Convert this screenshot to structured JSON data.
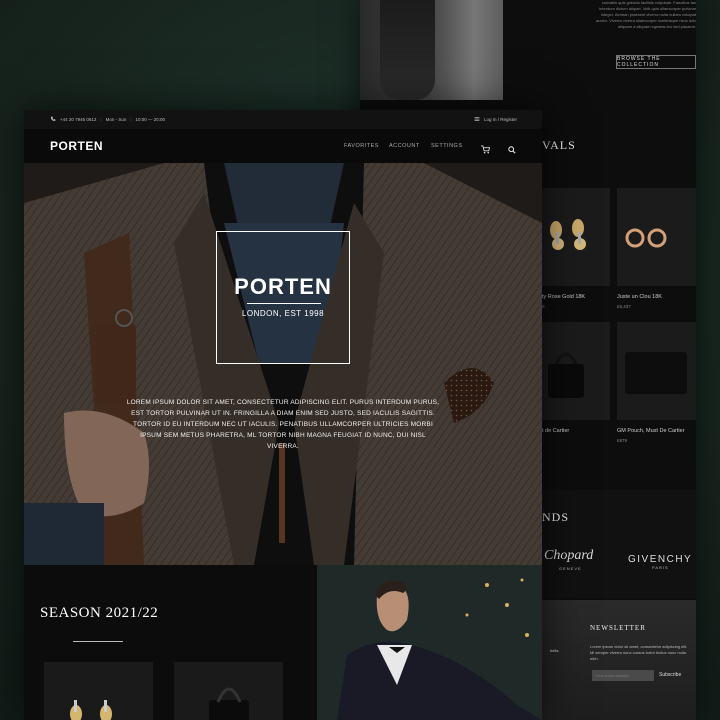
{
  "back": {
    "blurb_lines": [
      "convallis quis gravida facilisis vulputate. Faucibus fac",
      "Interdum dictum aliquet. Velit quis ullamcorper pulvinar",
      "integer. Aenean praesent viverra nulla nullam volutpat",
      "auctor. Viverra viverra ullamcorper scelerisque risus dolor",
      "aliquam a aliquam egestas leo sed placerat."
    ],
    "browse_label": "BROWSE THE COLLECTION",
    "arrivals_title": "VALS",
    "products": [
      {
        "name": "ty Rose Gold 18K",
        "price": "0"
      },
      {
        "name": "Juste un Clou 18K",
        "price": "£6,437"
      },
      {
        "name": "t de Cartier",
        "price": ""
      },
      {
        "name": "GM Pouch, Must De Cartier",
        "price": "£879"
      }
    ],
    "brands_title": "NDS",
    "brands": [
      {
        "name": "Chopard",
        "sub": "GENEVE"
      },
      {
        "name": "GIVENCHY",
        "sub": "PARIS"
      }
    ],
    "newsletter": {
      "title": "NEWSLETTER",
      "text": "Lorem ipsum dolor sit amet, consectetur adipiscing elit. Mi semper viverra nunc cursus tortor lectus nunc nulla nibh.",
      "side_label": "belts",
      "input_placeholder": "Your email address",
      "subscribe_label": "Subscribe"
    }
  },
  "topbar": {
    "phone": "+44 20 7946 0612",
    "days": "Mon - Sun",
    "hours": "10:00 — 20:00",
    "login": "Log In / Register"
  },
  "nav": {
    "logo": "PORTEN",
    "links": [
      "FAVORITES",
      "ACCOUNT",
      "SETTINGS"
    ]
  },
  "hero": {
    "brand": "PORTEN",
    "est": "LONDON, EST 1998",
    "text": "LOREM IPSUM DOLOR SIT AMET, CONSECTETUR ADIPISCING ELIT. PURUS INTERDUM PURUS, EST TORTOR PULVINAR UT IN. FRINGILLA A DIAM ENIM SED JUSTO, SED IACULIS SAGITTIS. TORTOR ID EU INTERDUM NEC UT IACULIS. PENATIBUS ULLAMCORPER ULTRICIES MORBI IPSUM SEM METUS PHARETRA, ML TORTOR NIBH MAGNA FEUGIAT ID NUNC, DUI NISL VIVERRA."
  },
  "season": {
    "title": "SEASON 2021/22"
  },
  "colors": {
    "background": "#1b2b25",
    "panel": "#0c0c0c",
    "text": "#ffffff"
  }
}
